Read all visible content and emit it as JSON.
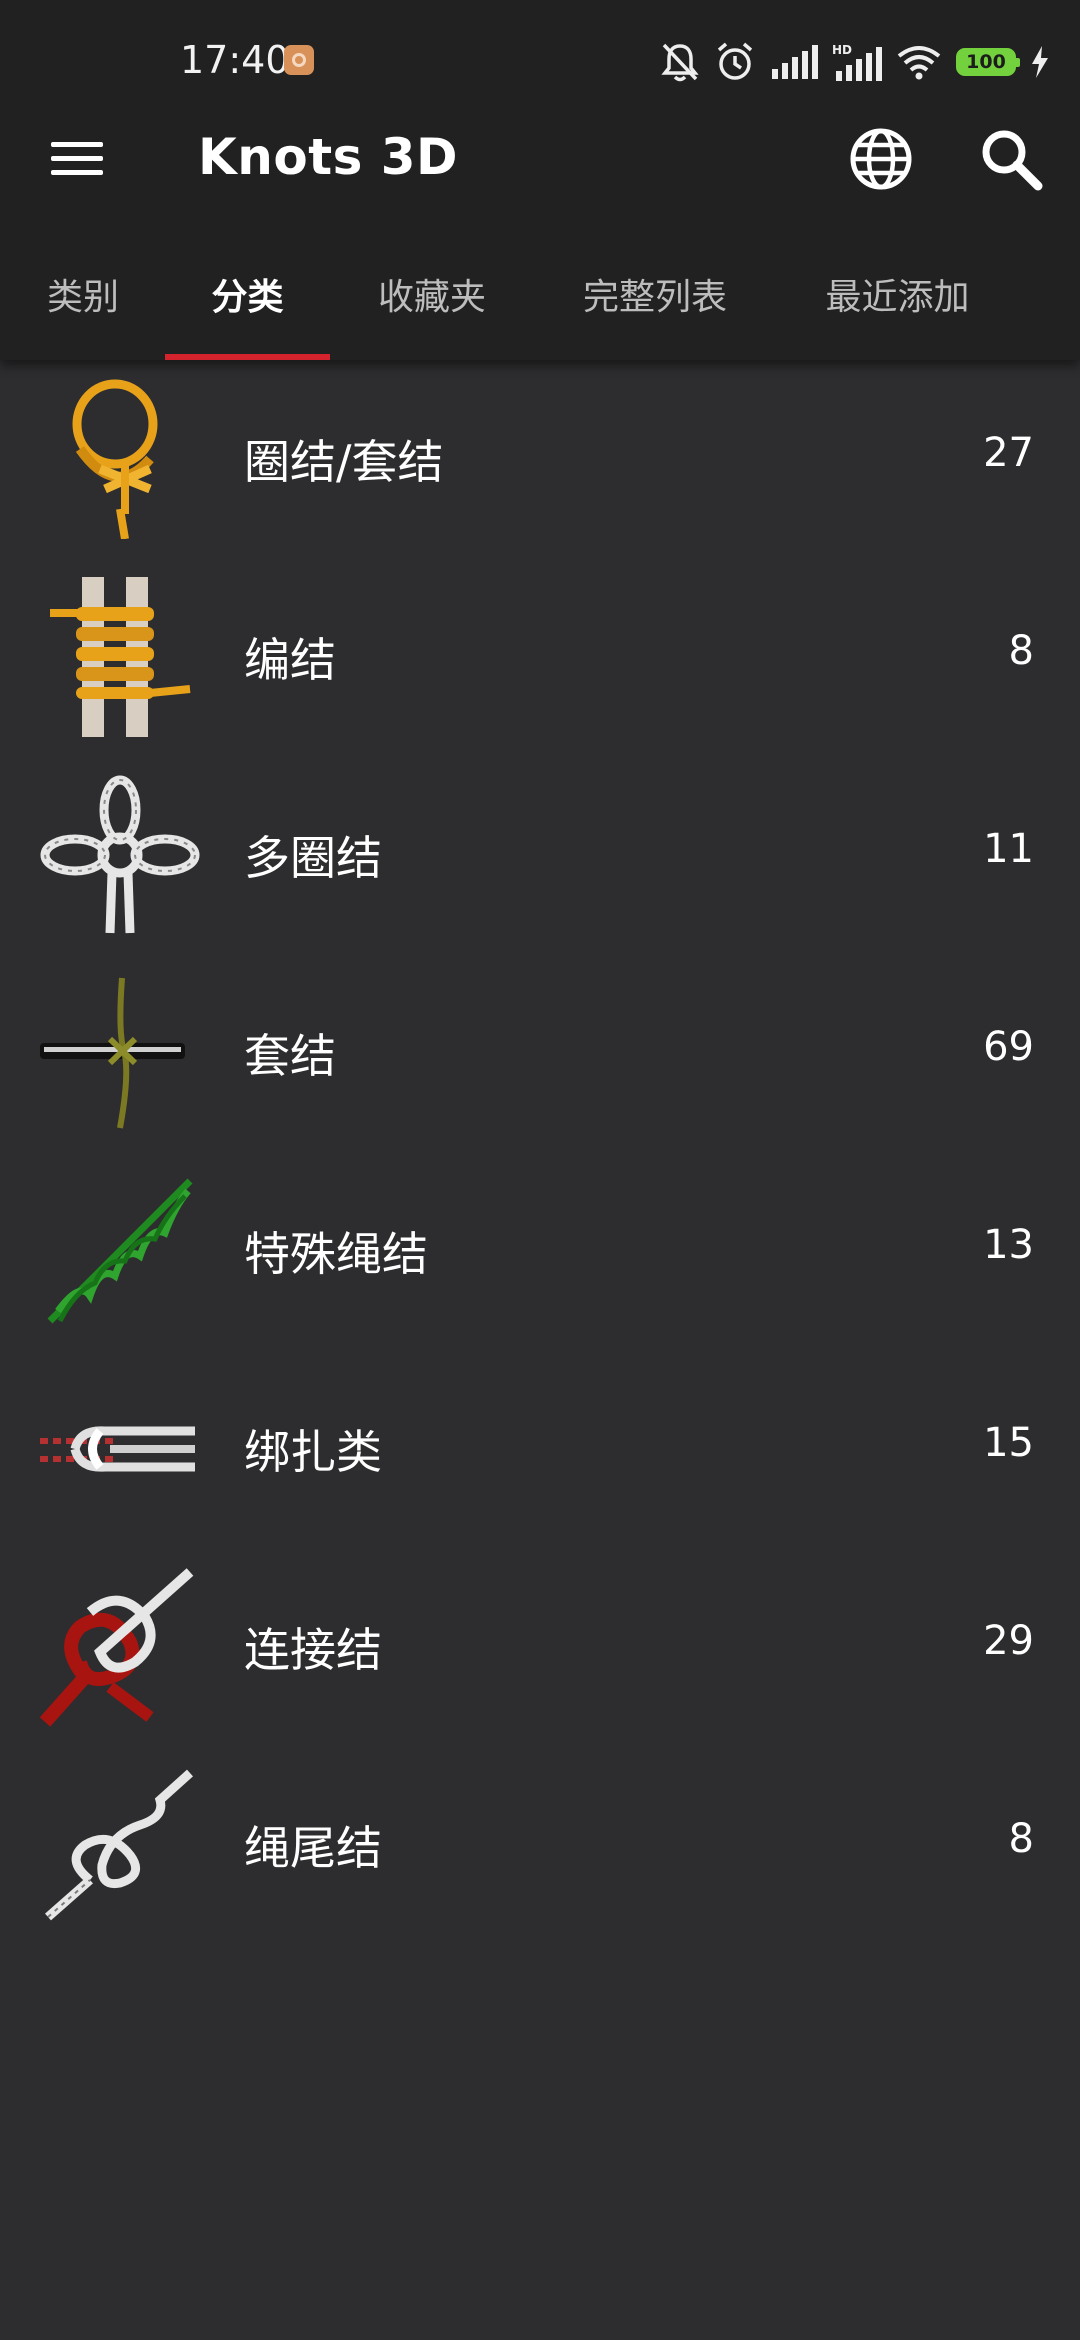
{
  "status_bar": {
    "time": "17:40",
    "battery": "100",
    "icons": [
      "notification-app-icon",
      "bell-off-icon",
      "alarm-icon",
      "signal-icon",
      "hd-signal-icon",
      "wifi-icon",
      "battery-icon",
      "charging-icon"
    ]
  },
  "app_bar": {
    "title": "Knots 3D",
    "icons": [
      "menu-icon",
      "globe-icon",
      "search-icon"
    ]
  },
  "tabs": [
    {
      "label": "类别",
      "active": false
    },
    {
      "label": "分类",
      "active": true
    },
    {
      "label": "收藏夹",
      "active": false
    },
    {
      "label": "完整列表",
      "active": false
    },
    {
      "label": "最近添加",
      "active": false
    }
  ],
  "colors": {
    "accent": "#d4232c",
    "toolbar_bg": "#212121",
    "list_bg": "#2d2d2f"
  },
  "categories": [
    {
      "label": "圈结/套结",
      "count": "27",
      "icon": "loop-knot-icon"
    },
    {
      "label": "编结",
      "count": "8",
      "icon": "lashing-knot-icon"
    },
    {
      "label": "多圈结",
      "count": "11",
      "icon": "multi-loop-knot-icon"
    },
    {
      "label": "套结",
      "count": "69",
      "icon": "hitch-knot-icon"
    },
    {
      "label": "特殊绳结",
      "count": "13",
      "icon": "special-knot-icon"
    },
    {
      "label": "绑扎类",
      "count": "15",
      "icon": "binding-knot-icon"
    },
    {
      "label": "连接结",
      "count": "29",
      "icon": "bend-knot-icon"
    },
    {
      "label": "绳尾结",
      "count": "8",
      "icon": "stopper-knot-icon"
    }
  ]
}
